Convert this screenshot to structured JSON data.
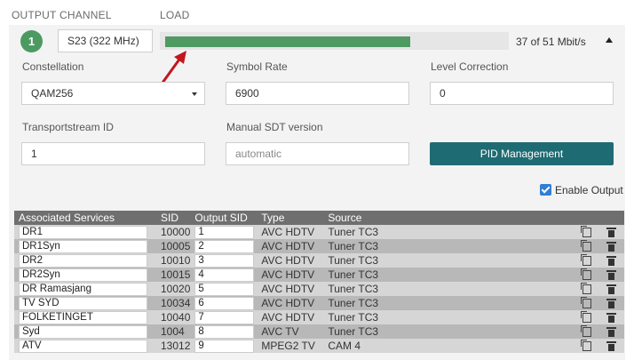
{
  "columns": {
    "output": "OUTPUT",
    "channel": "CHANNEL",
    "load": "LOAD"
  },
  "output_number": "1",
  "channel": {
    "value": "S23 (322 MHz)"
  },
  "load": {
    "text": "37 of 51 Mbit/s",
    "used": 37,
    "total": 51
  },
  "fields": {
    "constellation": {
      "label": "Constellation",
      "value": "QAM256"
    },
    "symbol_rate": {
      "label": "Symbol Rate",
      "value": "6900"
    },
    "level_correction": {
      "label": "Level Correction",
      "value": "0"
    },
    "transportstream_id": {
      "label": "Transportstream ID",
      "value": "1"
    },
    "manual_sdt": {
      "label": "Manual SDT version",
      "placeholder": "automatic"
    }
  },
  "pid_button": "PID Management",
  "enable_output": {
    "label": "Enable Output",
    "checked": true
  },
  "colors": {
    "accent": "#4c9a62",
    "button": "#1e6b73",
    "arrow": "#c0181f",
    "checkbox": "#2f7fd4"
  },
  "table": {
    "headers": [
      "Associated Services",
      "SID",
      "Output SID",
      "Type",
      "Source"
    ],
    "rows": [
      {
        "name": "DR1",
        "sid": "10000",
        "osid": "1",
        "type": "AVC HDTV",
        "source": "Tuner TC3"
      },
      {
        "name": "DR1Syn",
        "sid": "10005",
        "osid": "2",
        "type": "AVC HDTV",
        "source": "Tuner TC3"
      },
      {
        "name": "DR2",
        "sid": "10010",
        "osid": "3",
        "type": "AVC HDTV",
        "source": "Tuner TC3"
      },
      {
        "name": "DR2Syn",
        "sid": "10015",
        "osid": "4",
        "type": "AVC HDTV",
        "source": "Tuner TC3"
      },
      {
        "name": "DR Ramasjang",
        "sid": "10020",
        "osid": "5",
        "type": "AVC HDTV",
        "source": "Tuner TC3"
      },
      {
        "name": "TV SYD",
        "sid": "10034",
        "osid": "6",
        "type": "AVC HDTV",
        "source": "Tuner TC3"
      },
      {
        "name": "FOLKETINGET",
        "sid": "10040",
        "osid": "7",
        "type": "AVC HDTV",
        "source": "Tuner TC3"
      },
      {
        "name": "Syd",
        "sid": "1004",
        "osid": "8",
        "type": "AVC TV",
        "source": "Tuner TC3"
      },
      {
        "name": "ATV",
        "sid": "13012",
        "osid": "9",
        "type": "MPEG2 TV",
        "source": "CAM 4"
      }
    ]
  }
}
